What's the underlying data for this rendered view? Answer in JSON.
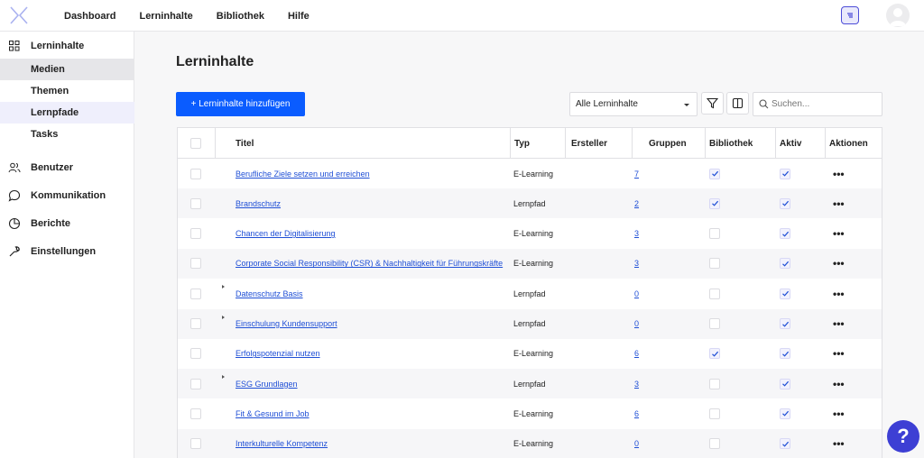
{
  "nav": {
    "items": [
      "Dashboard",
      "Lerninhalte",
      "Bibliothek",
      "Hilfe"
    ]
  },
  "sidebar": {
    "lerninhalte": "Lerninhalte",
    "sub": [
      "Medien",
      "Themen",
      "Lernpfade",
      "Tasks"
    ],
    "benutzer": "Benutzer",
    "kommunikation": "Kommunikation",
    "berichte": "Berichte",
    "einstellungen": "Einstellungen"
  },
  "main": {
    "title": "Lerninhalte",
    "add_button": "+ Lerninhalte hinzufügen",
    "filter_value": "Alle Lerninhalte",
    "search_placeholder": "Suchen..."
  },
  "table": {
    "headers": {
      "titel": "Titel",
      "typ": "Typ",
      "ersteller": "Ersteller",
      "gruppen": "Gruppen",
      "bibliothek": "Bibliothek",
      "aktiv": "Aktiv",
      "aktionen": "Aktionen"
    },
    "rows": [
      {
        "titel": "Berufliche Ziele setzen und erreichen",
        "typ": "E-Learning",
        "gruppen": "7",
        "bibliothek": true,
        "aktiv": true,
        "expandable": false,
        "actions": "•••"
      },
      {
        "titel": "Brandschutz",
        "typ": "Lernpfad",
        "gruppen": "2",
        "bibliothek": true,
        "aktiv": true,
        "expandable": false,
        "actions": "•••"
      },
      {
        "titel": "Chancen der Digitalisierung",
        "typ": "E-Learning",
        "gruppen": "3",
        "bibliothek": false,
        "aktiv": true,
        "expandable": false,
        "actions": "•••"
      },
      {
        "titel": "Corporate Social Responsibility (CSR) & Nachhaltigkeit für Führungskräfte",
        "typ": "E-Learning",
        "gruppen": "3",
        "bibliothek": false,
        "aktiv": true,
        "expandable": false,
        "actions": "•••"
      },
      {
        "titel": "Datenschutz Basis",
        "typ": "Lernpfad",
        "gruppen": "0",
        "bibliothek": false,
        "aktiv": true,
        "expandable": true,
        "actions": "•••"
      },
      {
        "titel": "Einschulung Kundensupport",
        "typ": "Lernpfad",
        "gruppen": "0",
        "bibliothek": false,
        "aktiv": true,
        "expandable": true,
        "actions": "•••"
      },
      {
        "titel": "Erfolgspotenzial nutzen",
        "typ": "E-Learning",
        "gruppen": "6",
        "bibliothek": true,
        "aktiv": true,
        "expandable": false,
        "actions": "•••"
      },
      {
        "titel": "ESG Grundlagen",
        "typ": "Lernpfad",
        "gruppen": "3",
        "bibliothek": false,
        "aktiv": true,
        "expandable": true,
        "actions": "•••"
      },
      {
        "titel": "Fit & Gesund im Job",
        "typ": "E-Learning",
        "gruppen": "6",
        "bibliothek": false,
        "aktiv": true,
        "expandable": false,
        "actions": "•••"
      },
      {
        "titel": "Interkulturelle Kompetenz",
        "typ": "E-Learning",
        "gruppen": "0",
        "bibliothek": false,
        "aktiv": true,
        "expandable": false,
        "actions": "•••"
      }
    ]
  },
  "help": {
    "label": "?"
  },
  "colors": {
    "accent": "#0a5cff",
    "help": "#3d3fd4",
    "link": "#1f4fd6"
  },
  "icons": {
    "logo": "logo-icon",
    "notifications": "notification-icon",
    "avatar": "user-avatar",
    "lerninhalte": "grid-icon",
    "benutzer": "users-icon",
    "kommunikation": "chat-icon",
    "berichte": "pie-chart-icon",
    "einstellungen": "wrench-icon",
    "filter": "filter-icon",
    "columns": "columns-icon",
    "search": "search-icon"
  }
}
